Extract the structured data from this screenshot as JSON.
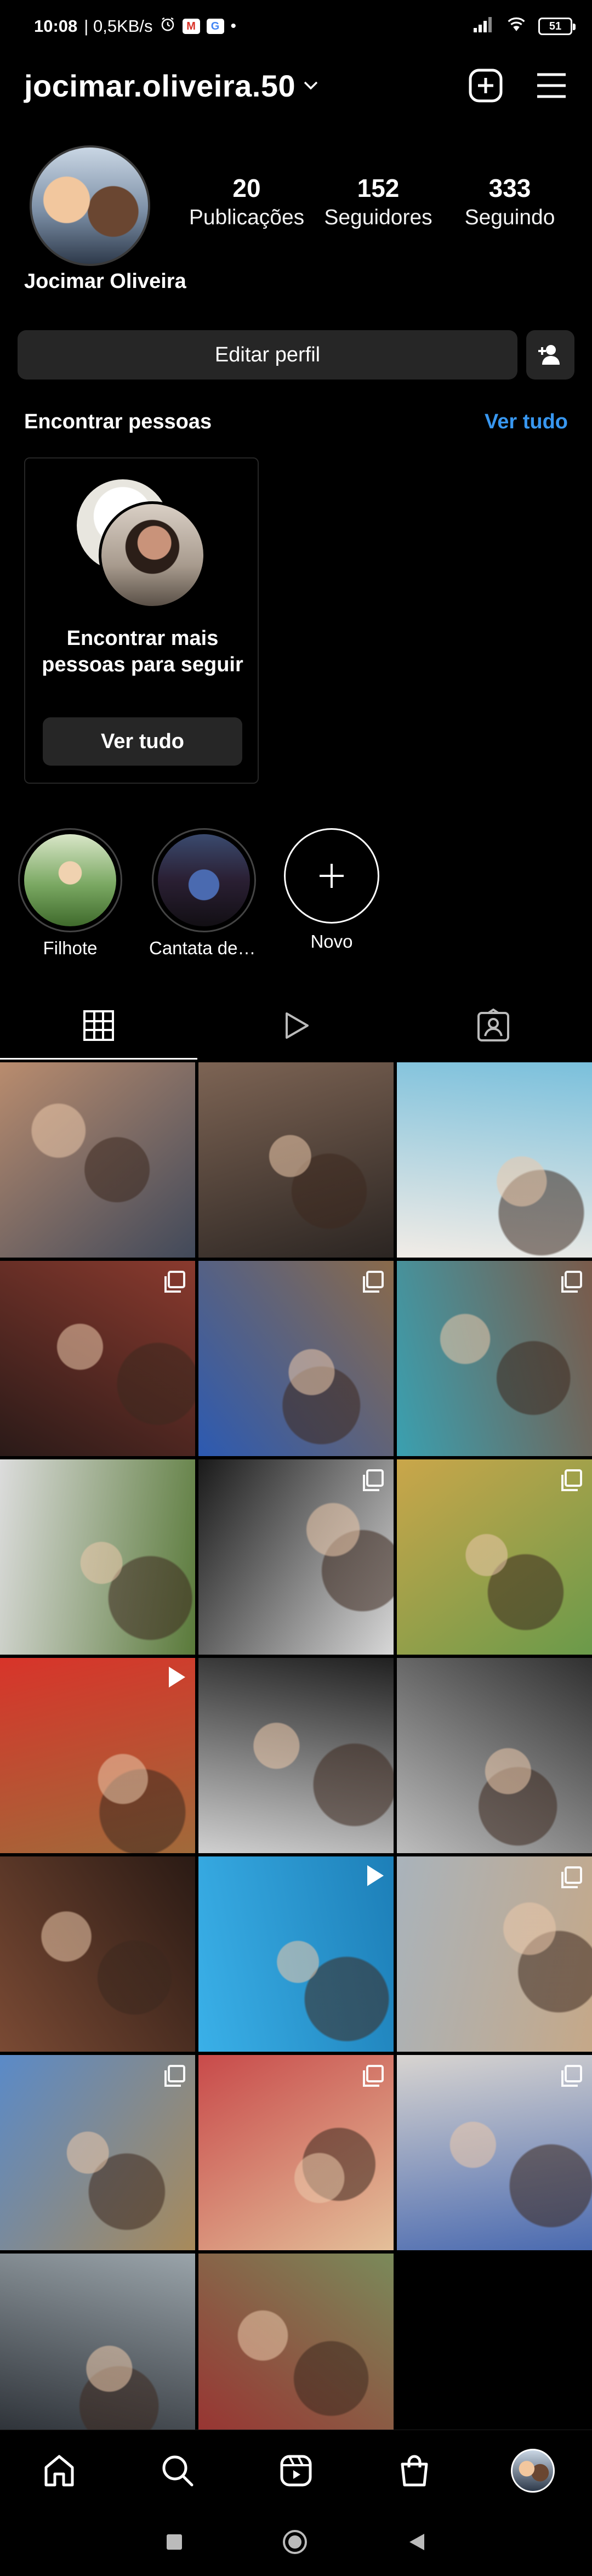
{
  "status_bar": {
    "time": "10:08",
    "speed": "| 0,5KB/s",
    "battery": "51",
    "colors": {
      "gmail": "#d93025",
      "assistant": "#4285f4"
    }
  },
  "header": {
    "username": "jocimar.oliveira.50",
    "icons": [
      "chevron-down-icon",
      "new-post-icon",
      "menu-icon"
    ]
  },
  "profile": {
    "full_name": "Jocimar Oliveira",
    "stats": [
      {
        "value": "20",
        "label": "Publicações"
      },
      {
        "value": "152",
        "label": "Seguidores"
      },
      {
        "value": "333",
        "label": "Seguindo"
      }
    ],
    "edit_label": "Editar perfil"
  },
  "discover": {
    "title": "Encontrar pessoas",
    "see_all": "Ver tudo",
    "card_text": "Encontrar mais pessoas para seguir",
    "card_button": "Ver tudo"
  },
  "highlights": [
    {
      "label": "Filhote",
      "colors": [
        "#d9e6c8",
        "#3f6a2c"
      ]
    },
    {
      "label": "Cantata de N…",
      "colors": [
        "#3a4a6e",
        "#120f14"
      ]
    },
    {
      "label": "Novo"
    }
  ],
  "tabs": [
    "grid-icon",
    "reels-icon",
    "tagged-icon"
  ],
  "grid": [
    {
      "type": "photo",
      "colors": [
        "#b98c6e",
        "#41495a"
      ]
    },
    {
      "type": "photo",
      "colors": [
        "#7d6454",
        "#2b2522"
      ]
    },
    {
      "type": "photo",
      "colors": [
        "#7ac0dc",
        "#f2ece6"
      ]
    },
    {
      "type": "multi",
      "colors": [
        "#8a3a2e",
        "#2a1a18"
      ]
    },
    {
      "type": "multi",
      "colors": [
        "#8a6a4a",
        "#2c5ab2"
      ]
    },
    {
      "type": "multi",
      "colors": [
        "#7a5a4a",
        "#3aa0b0"
      ]
    },
    {
      "type": "photo",
      "colors": [
        "#5a7a3a",
        "#dcdcdc"
      ]
    },
    {
      "type": "multi",
      "colors": [
        "#d8d8d8",
        "#1a1a1a"
      ]
    },
    {
      "type": "multi",
      "colors": [
        "#6a9a4a",
        "#caa64a"
      ]
    },
    {
      "type": "reel",
      "colors": [
        "#a06a3a",
        "#d8342a"
      ]
    },
    {
      "type": "photo",
      "colors": [
        "#d0d0d0",
        "#202020"
      ]
    },
    {
      "type": "photo",
      "colors": [
        "#bdbdbd",
        "#303030"
      ]
    },
    {
      "type": "photo",
      "colors": [
        "#7a4a34",
        "#2a1a14"
      ]
    },
    {
      "type": "reel",
      "colors": [
        "#3ab0e8",
        "#1d7fb8"
      ]
    },
    {
      "type": "multi",
      "colors": [
        "#a9b3bb",
        "#c5a888"
      ]
    },
    {
      "type": "multi",
      "colors": [
        "#5a8ac8",
        "#a88a5a"
      ]
    },
    {
      "type": "multi",
      "colors": [
        "#c84a4a",
        "#e4c09a"
      ]
    },
    {
      "type": "multi",
      "colors": [
        "#d8d4d0",
        "#4a6ab0"
      ]
    },
    {
      "type": "photo",
      "colors": [
        "#9aa4aa",
        "#262a30"
      ]
    },
    {
      "type": "photo",
      "colors": [
        "#7a8a5a",
        "#9a3030"
      ]
    }
  ],
  "bottom_nav": [
    "home-icon",
    "search-icon",
    "reels-nav-icon",
    "shop-icon",
    "profile-avatar"
  ],
  "system_nav": [
    "recents-icon",
    "home-circle-icon",
    "back-icon"
  ]
}
